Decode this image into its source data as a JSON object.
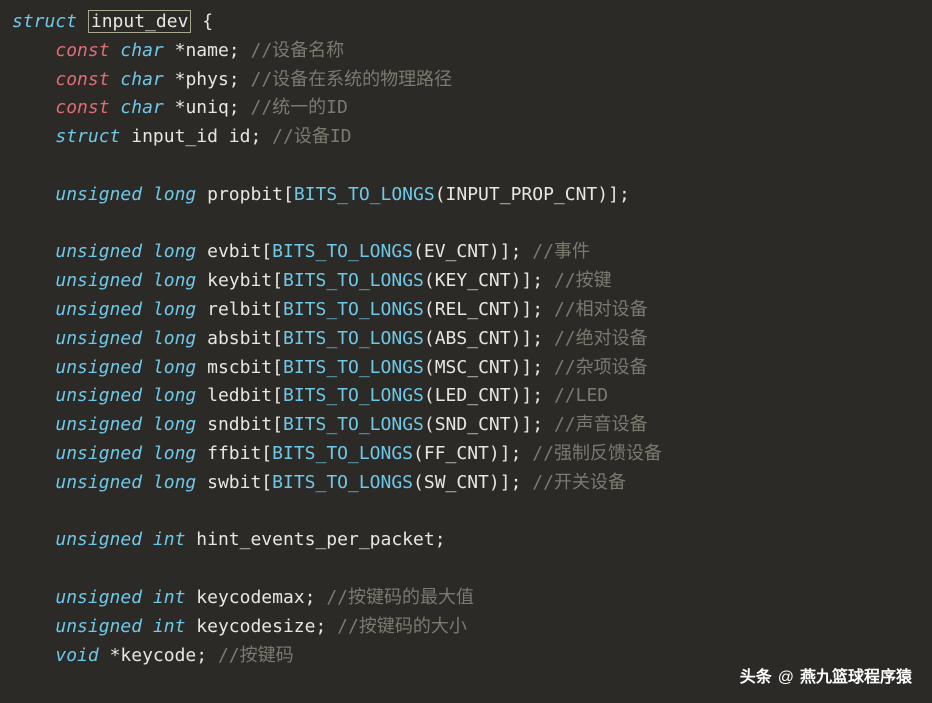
{
  "code": {
    "line1": {
      "kw": "struct",
      "name": "input_dev",
      "brace": "{"
    },
    "line2": {
      "kw1": "const",
      "kw2": "char",
      "star": "*",
      "name": "name",
      "semi": ";",
      "comment": "//设备名称"
    },
    "line3": {
      "kw1": "const",
      "kw2": "char",
      "star": "*",
      "name": "phys",
      "semi": ";",
      "comment": "//设备在系统的物理路径"
    },
    "line4": {
      "kw1": "const",
      "kw2": "char",
      "star": "*",
      "name": "uniq",
      "semi": ";",
      "comment": "//统一的ID"
    },
    "line5": {
      "kw": "struct",
      "type": "input_id",
      "name": "id",
      "semi": ";",
      "comment": "//设备ID"
    },
    "line7": {
      "kw1": "unsigned",
      "kw2": "long",
      "name": "propbit",
      "func": "BITS_TO_LONGS",
      "arg": "INPUT_PROP_CNT",
      "semi": ";"
    },
    "line9": {
      "kw1": "unsigned",
      "kw2": "long",
      "name": "evbit",
      "func": "BITS_TO_LONGS",
      "arg": "EV_CNT",
      "semi": ";",
      "comment": "//事件"
    },
    "line10": {
      "kw1": "unsigned",
      "kw2": "long",
      "name": "keybit",
      "func": "BITS_TO_LONGS",
      "arg": "KEY_CNT",
      "semi": ";",
      "comment": "//按键"
    },
    "line11": {
      "kw1": "unsigned",
      "kw2": "long",
      "name": "relbit",
      "func": "BITS_TO_LONGS",
      "arg": "REL_CNT",
      "semi": ";",
      "comment": "//相对设备"
    },
    "line12": {
      "kw1": "unsigned",
      "kw2": "long",
      "name": "absbit",
      "func": "BITS_TO_LONGS",
      "arg": "ABS_CNT",
      "semi": ";",
      "comment": "//绝对设备"
    },
    "line13": {
      "kw1": "unsigned",
      "kw2": "long",
      "name": "mscbit",
      "func": "BITS_TO_LONGS",
      "arg": "MSC_CNT",
      "semi": ";",
      "comment": "//杂项设备"
    },
    "line14": {
      "kw1": "unsigned",
      "kw2": "long",
      "name": "ledbit",
      "func": "BITS_TO_LONGS",
      "arg": "LED_CNT",
      "semi": ";",
      "comment": "//LED"
    },
    "line15": {
      "kw1": "unsigned",
      "kw2": "long",
      "name": "sndbit",
      "func": "BITS_TO_LONGS",
      "arg": "SND_CNT",
      "semi": ";",
      "comment": "//声音设备"
    },
    "line16": {
      "kw1": "unsigned",
      "kw2": "long",
      "name": "ffbit",
      "func": "BITS_TO_LONGS",
      "arg": "FF_CNT",
      "semi": ";",
      "comment": "//强制反馈设备"
    },
    "line17": {
      "kw1": "unsigned",
      "kw2": "long",
      "name": "swbit",
      "func": "BITS_TO_LONGS",
      "arg": "SW_CNT",
      "semi": ";",
      "comment": "//开关设备"
    },
    "line19": {
      "kw1": "unsigned",
      "kw2": "int",
      "name": "hint_events_per_packet",
      "semi": ";"
    },
    "line21": {
      "kw1": "unsigned",
      "kw2": "int",
      "name": "keycodemax",
      "semi": ";",
      "comment": "//按键码的最大值"
    },
    "line22": {
      "kw1": "unsigned",
      "kw2": "int",
      "name": "keycodesize",
      "semi": ";",
      "comment": "//按键码的大小"
    },
    "line23": {
      "kw": "void",
      "star": "*",
      "name": "keycode",
      "semi": ";",
      "comment": "//按键码"
    }
  },
  "watermark": {
    "label": "头条",
    "at": "@",
    "author": "燕九篮球程序猿"
  }
}
